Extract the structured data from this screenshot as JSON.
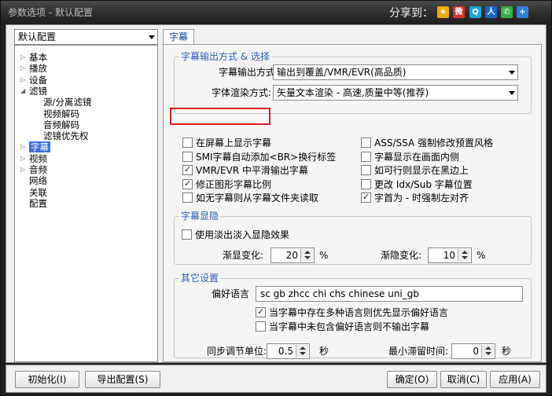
{
  "window": {
    "title": "参数选项 - 默认配置",
    "share_label": "分享到：",
    "share_icons": [
      {
        "name": "qzone-icon",
        "glyph": "★",
        "color": "#f2a90c"
      },
      {
        "name": "sina-weibo-icon",
        "glyph": "微",
        "color": "#e0302a"
      },
      {
        "name": "tencent-weibo-icon",
        "glyph": "Q",
        "color": "#1fa3d9"
      },
      {
        "name": "renren-icon",
        "glyph": "人",
        "color": "#1767c6"
      },
      {
        "name": "wechat-icon",
        "glyph": "✆",
        "color": "#37b04b"
      },
      {
        "name": "more-share-icon",
        "glyph": "+",
        "color": "#2f7fe0"
      }
    ]
  },
  "profile_select": {
    "value": "默认配置"
  },
  "tree": {
    "items": [
      {
        "label": "基本",
        "level": 0,
        "expander": "▷"
      },
      {
        "label": "播放",
        "level": 0,
        "expander": "▷"
      },
      {
        "label": "设备",
        "level": 0,
        "expander": "▷"
      },
      {
        "label": "滤镜",
        "level": 0,
        "expander": "◢"
      },
      {
        "label": "源/分离滤镜",
        "level": 1,
        "expander": ""
      },
      {
        "label": "视频解码",
        "level": 1,
        "expander": ""
      },
      {
        "label": "音频解码",
        "level": 1,
        "expander": ""
      },
      {
        "label": "滤镜优先权",
        "level": 1,
        "expander": ""
      },
      {
        "label": "字幕",
        "level": 0,
        "expander": "▷",
        "selected": true
      },
      {
        "label": "视频",
        "level": 0,
        "expander": "▷"
      },
      {
        "label": "音频",
        "level": 0,
        "expander": "▷"
      },
      {
        "label": "网络",
        "level": 0,
        "expander": ""
      },
      {
        "label": "关联",
        "level": 0,
        "expander": ""
      },
      {
        "label": "配置",
        "level": 0,
        "expander": ""
      }
    ]
  },
  "tab": {
    "label": "字幕"
  },
  "output_group": {
    "title": "字幕输出方式 & 选择",
    "output_mode_label": "字幕输出方式：",
    "output_mode_value": "输出到覆盖/VMR/EVR(高品质)",
    "render_mode_label": "字体渲染方式:",
    "render_mode_value": "矢量文本渲染 - 高速,质量中等(推荐)"
  },
  "checks_left": [
    {
      "label": "在屏幕上显示字幕",
      "checked": false
    },
    {
      "label": "SMI字幕自动添加<BR>换行标签",
      "checked": false
    },
    {
      "label": "VMR/EVR 中平滑输出字幕",
      "checked": true
    },
    {
      "label": "修正图形字幕比例",
      "checked": true
    },
    {
      "label": "如无字幕则从字幕文件夹读取",
      "checked": false
    }
  ],
  "checks_right": [
    {
      "label": "ASS/SSA 强制修改预置风格",
      "checked": false
    },
    {
      "label": "字幕显示在画面内侧",
      "checked": false
    },
    {
      "label": "如可行则显示在黑边上",
      "checked": false
    },
    {
      "label": "更改 Idx/Sub 字幕位置",
      "checked": false
    },
    {
      "label": "字首为 - 时强制左对齐",
      "checked": true
    }
  ],
  "fade_group": {
    "title": "字幕显隐",
    "fade_check": {
      "label": "使用淡出淡入显隐效果",
      "checked": false
    },
    "fade_in_label": "渐显变化:",
    "fade_in_value": "20",
    "fade_in_unit": "%",
    "fade_out_label": "渐隐变化:",
    "fade_out_value": "10",
    "fade_out_unit": "%"
  },
  "other_group": {
    "title": "其它设置",
    "pref_lang_label": "偏好语言",
    "pref_lang_value": "sc gb zhcc chi chs chinese uni_gb",
    "check_multi": {
      "label": "当字幕中存在多种语言则优先显示偏好语言",
      "checked": true
    },
    "check_no_pref": {
      "label": "当字幕中未包含偏好语言则不输出字幕",
      "checked": false
    },
    "sync_label": "同步调节单位:",
    "sync_value": "0.5",
    "sync_unit": "秒",
    "min_stay_label": "最小滞留时间:",
    "min_stay_value": "0",
    "min_stay_unit": "秒"
  },
  "footer": {
    "init_label": "初始化(I)",
    "export_label": "导出配置(S)",
    "ok_label": "确定(O)",
    "cancel_label": "取消(C)",
    "apply_label": "应用(A)"
  }
}
